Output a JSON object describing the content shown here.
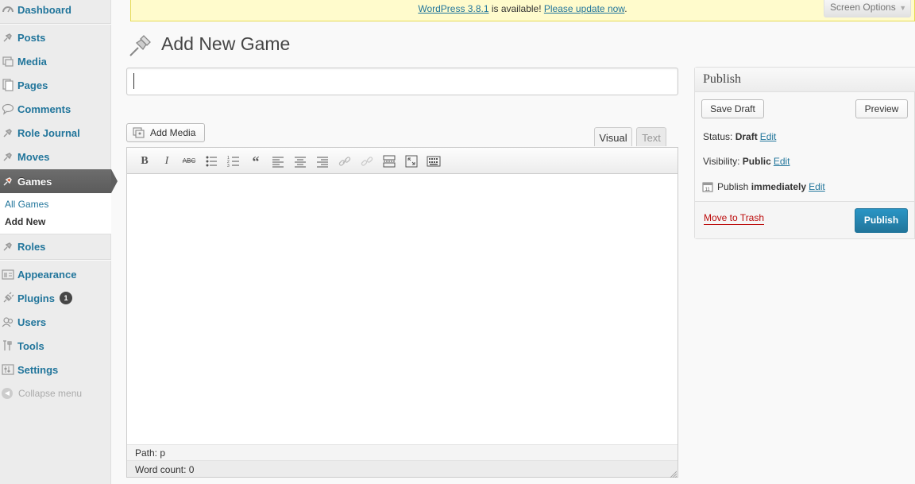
{
  "sidebar": {
    "items": [
      {
        "label": "Dashboard",
        "icon": "dashboard-icon"
      },
      {
        "label": "Posts",
        "icon": "pin-icon"
      },
      {
        "label": "Media",
        "icon": "media-icon"
      },
      {
        "label": "Pages",
        "icon": "pages-icon"
      },
      {
        "label": "Comments",
        "icon": "comments-icon"
      },
      {
        "label": "Role Journal",
        "icon": "pin-icon"
      },
      {
        "label": "Moves",
        "icon": "pin-icon"
      },
      {
        "label": "Games",
        "icon": "pin-icon",
        "active": true
      },
      {
        "label": "Roles",
        "icon": "pin-icon"
      },
      {
        "label": "Appearance",
        "icon": "appearance-icon"
      },
      {
        "label": "Plugins",
        "icon": "plugins-icon",
        "badge": "1"
      },
      {
        "label": "Users",
        "icon": "users-icon"
      },
      {
        "label": "Tools",
        "icon": "tools-icon"
      },
      {
        "label": "Settings",
        "icon": "settings-icon"
      }
    ],
    "submenu": {
      "all": "All Games",
      "add_new": "Add New"
    },
    "collapse": "Collapse menu"
  },
  "nag": {
    "link1": "WordPress 3.8.1",
    "middle": " is available! ",
    "link2": "Please update now",
    "end": "."
  },
  "screen_options": "Screen Options",
  "page_title": "Add New Game",
  "title_input": {
    "value": ""
  },
  "editor": {
    "add_media": "Add Media",
    "tab_visual": "Visual",
    "tab_text": "Text",
    "toolbar": {
      "bold": "B",
      "italic": "I",
      "strike": "ABC"
    },
    "path": "Path: p",
    "word_count": "Word count: 0"
  },
  "publish": {
    "heading": "Publish",
    "save_draft": "Save Draft",
    "preview": "Preview",
    "status_label": "Status: ",
    "status_value": "Draft",
    "visibility_label": "Visibility: ",
    "visibility_value": "Public",
    "publish_label": "Publish ",
    "publish_value": "immediately",
    "edit": "Edit",
    "trash": "Move to Trash",
    "publish_button": "Publish"
  },
  "colors": {
    "link": "#21759b",
    "active_menu": "#5b5b5b",
    "nag_bg": "#fffbcc",
    "publish_button": "#21759b",
    "trash": "#bc0b0b"
  }
}
